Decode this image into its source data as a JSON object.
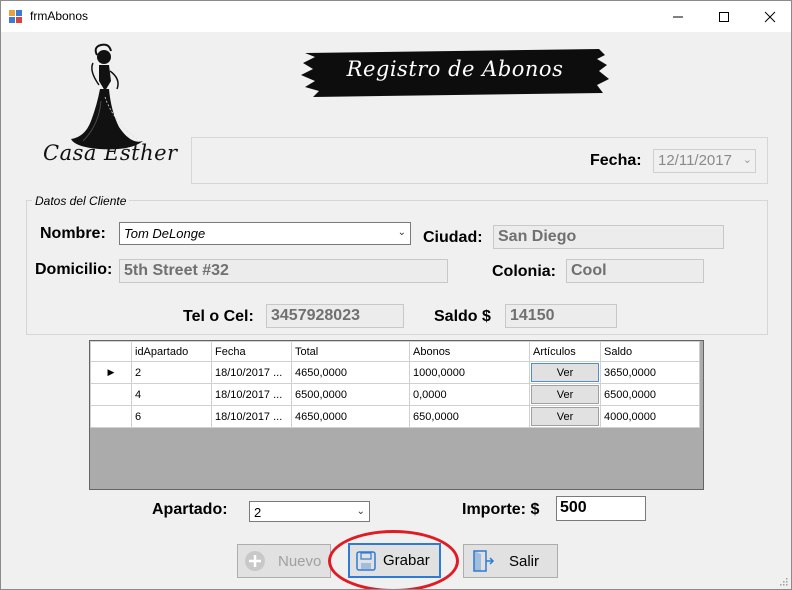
{
  "window": {
    "title": "frmAbonos",
    "app_icon": "winforms-icon",
    "controls": [
      "minimize-icon",
      "maximize-icon",
      "close-icon"
    ]
  },
  "logo": {
    "text": "Casa Esther",
    "icon": "dress-silhouette-icon"
  },
  "banner": {
    "text": "Registro de Abonos"
  },
  "fecha": {
    "label": "Fecha:",
    "value": "12/11/2017"
  },
  "cliente": {
    "group_title": "Datos del Cliente",
    "nombre_label": "Nombre:",
    "nombre_value": "Tom DeLonge",
    "ciudad_label": "Ciudad:",
    "ciudad_value": "San Diego",
    "domicilio_label": "Domicilio:",
    "domicilio_value": "5th Street #32",
    "colonia_label": "Colonia:",
    "colonia_value": "Cool",
    "tel_label": "Tel o Cel:",
    "tel_value": "3457928023",
    "saldo_label": "Saldo $",
    "saldo_value": "14150"
  },
  "grid": {
    "columns": [
      "idApartado",
      "Fecha",
      "Total",
      "Abonos",
      "Artículos",
      "Saldo"
    ],
    "rows": [
      {
        "idApartado": "2",
        "fecha": "18/10/2017 ...",
        "total": "4650,0000",
        "abonos": "1000,0000",
        "articulos": "Ver",
        "saldo": "3650,0000"
      },
      {
        "idApartado": "4",
        "fecha": "18/10/2017 ...",
        "total": "6500,0000",
        "abonos": "0,0000",
        "articulos": "Ver",
        "saldo": "6500,0000"
      },
      {
        "idApartado": "6",
        "fecha": "18/10/2017 ...",
        "total": "4650,0000",
        "abonos": "650,0000",
        "articulos": "Ver",
        "saldo": "4000,0000"
      }
    ],
    "current_row_marker": "▶"
  },
  "apartado": {
    "label": "Apartado:",
    "value": "2"
  },
  "importe": {
    "label": "Importe: $",
    "value": "500"
  },
  "buttons": {
    "nuevo": "Nuevo",
    "grabar": "Grabar",
    "salir": "Salir"
  },
  "colors": {
    "highlight_ellipse": "#e01b24",
    "focus_border": "#2d7bd4",
    "form_bg": "#f0f0f0",
    "grid_bg": "#ababab"
  }
}
